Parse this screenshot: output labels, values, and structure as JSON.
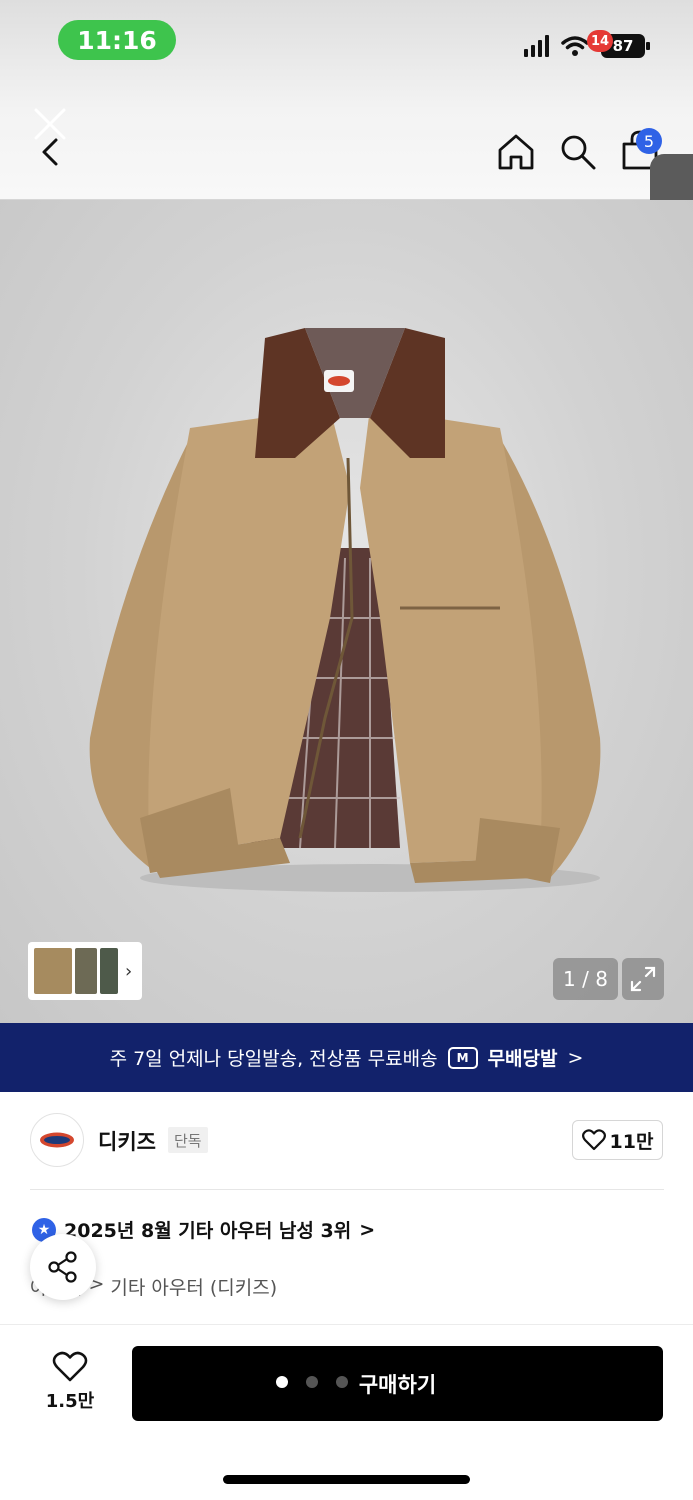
{
  "status_bar": {
    "time": "11:16",
    "notification_count": "14",
    "battery_level": "87"
  },
  "header": {
    "cart_count": "5",
    "icons": [
      "close-icon",
      "back-icon",
      "home-icon",
      "search-icon",
      "shopping-bag-icon"
    ]
  },
  "gallery": {
    "page_indicator": "1 / 8"
  },
  "promo": {
    "text": "주 7일 언제나 당일발송, 전상품 무료배송",
    "badge_label": "무배당발",
    "chevron": ">"
  },
  "brand": {
    "name": "디키즈",
    "tag": "단독",
    "like_count": "11만"
  },
  "ranking": {
    "text": "2025년 8월 기타 아우터 남성 3위",
    "chevron": ">"
  },
  "breadcrumb": {
    "parent": "아우터",
    "separator": ">",
    "current": "기타 아우터 (디키즈)"
  },
  "bottom_bar": {
    "wish_count": "1.5만",
    "buy_label": "구매하기"
  },
  "colors": {
    "status_pill": "#3ec44d",
    "promo_bg": "#12226b",
    "badge_blue": "#2f62e6",
    "buy_button": "#000000"
  }
}
